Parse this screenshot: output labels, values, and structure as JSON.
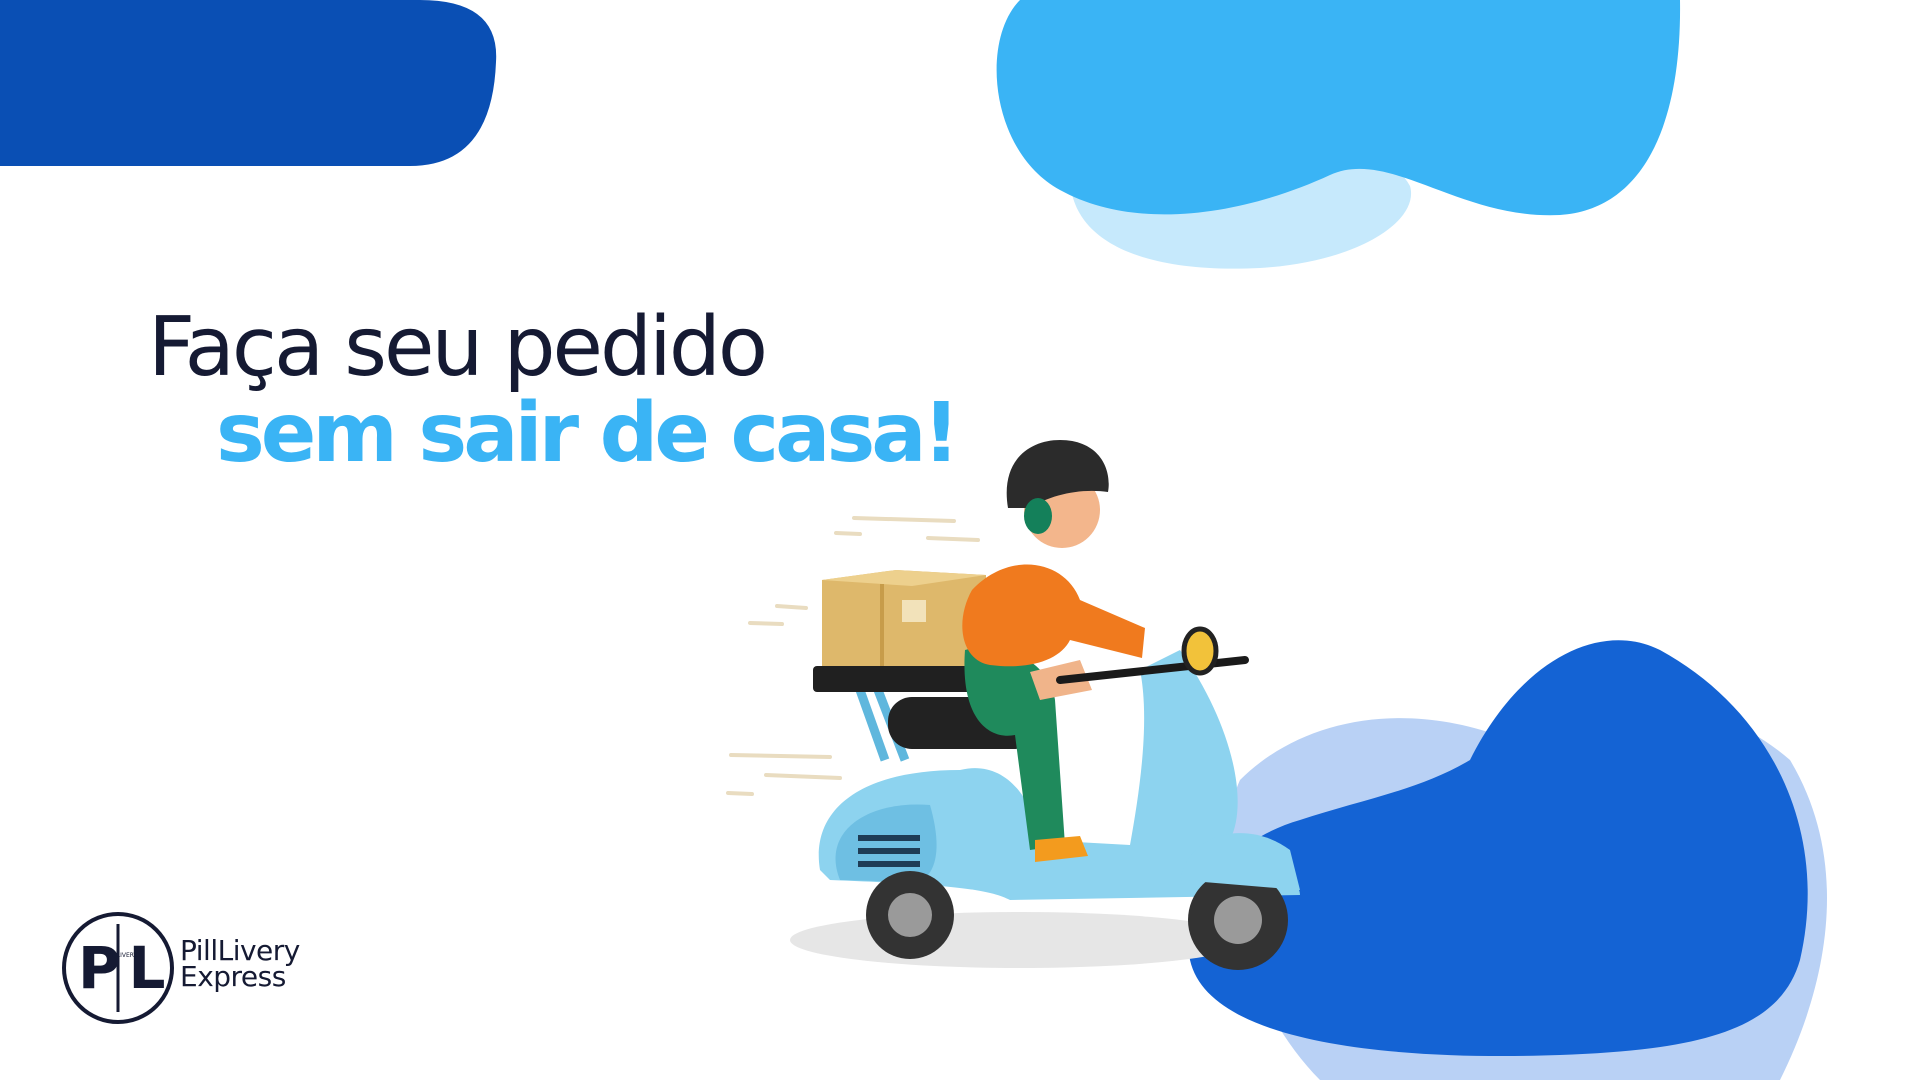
{
  "headline": {
    "line1": "Faça seu pedido",
    "line2": "sem sair de casa!"
  },
  "brand": {
    "monogram": "PL",
    "small_vertical": "PILLIVERY",
    "name_line1": "PillLivery",
    "name_line2": "Express"
  },
  "colors": {
    "navy": "#151a33",
    "accent": "#3ab4f5",
    "deep_blue": "#0a4fb4",
    "blob_blue": "#1463d4",
    "light_blue": "#c6e9fc"
  },
  "illustration": {
    "subject": "delivery-person-on-scooter"
  }
}
